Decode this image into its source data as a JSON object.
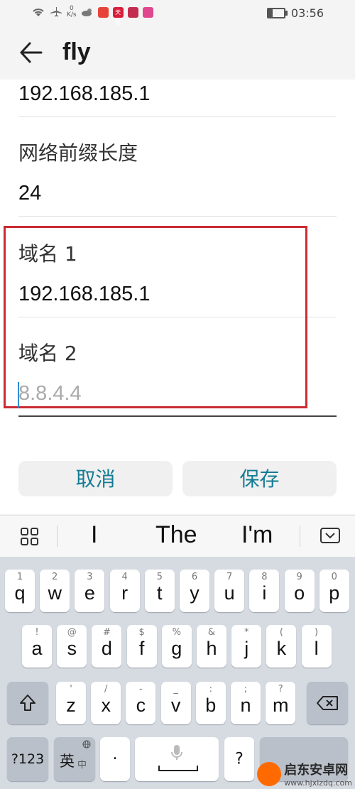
{
  "status": {
    "net_speed": "0",
    "net_unit": "K/s",
    "time": "03:56",
    "app_colors": [
      "#e8433a",
      "#d81e3c",
      "#c42c4f",
      "#e0478f"
    ],
    "app_text": "天猫"
  },
  "header": {
    "title": "fly",
    "back_icon": "arrow-left-icon"
  },
  "form": {
    "gateway_value": "192.168.185.1",
    "prefix_label": "网络前缀长度",
    "prefix_value": "24",
    "dns1_label": "域名 1",
    "dns1_value": "192.168.185.1",
    "dns2_label": "域名 2",
    "dns2_placeholder": "8.8.4.4",
    "highlight_color": "#cc2b33"
  },
  "buttons": {
    "cancel": "取消",
    "save": "保存",
    "accent": "#137b94"
  },
  "keyboard": {
    "suggestions": [
      "I",
      "The",
      "I'm"
    ],
    "row1": [
      {
        "sub": "1",
        "main": "q"
      },
      {
        "sub": "2",
        "main": "w"
      },
      {
        "sub": "3",
        "main": "e"
      },
      {
        "sub": "4",
        "main": "r"
      },
      {
        "sub": "5",
        "main": "t"
      },
      {
        "sub": "6",
        "main": "y"
      },
      {
        "sub": "7",
        "main": "u"
      },
      {
        "sub": "8",
        "main": "i"
      },
      {
        "sub": "9",
        "main": "o"
      },
      {
        "sub": "0",
        "main": "p"
      }
    ],
    "row2": [
      {
        "sub": "!",
        "main": "a"
      },
      {
        "sub": "@",
        "main": "s"
      },
      {
        "sub": "#",
        "main": "d"
      },
      {
        "sub": "$",
        "main": "f"
      },
      {
        "sub": "%",
        "main": "g"
      },
      {
        "sub": "&",
        "main": "h"
      },
      {
        "sub": "*",
        "main": "j"
      },
      {
        "sub": "(",
        "main": "k"
      },
      {
        "sub": ")",
        "main": "l"
      }
    ],
    "row3": [
      {
        "sub": "'",
        "main": "z"
      },
      {
        "sub": "/",
        "main": "x"
      },
      {
        "sub": "-",
        "main": "c"
      },
      {
        "sub": "_",
        "main": "v"
      },
      {
        "sub": ":",
        "main": "b"
      },
      {
        "sub": ";",
        "main": "n"
      },
      {
        "sub": "?",
        "main": "m"
      }
    ],
    "num_key": "?123",
    "lang_key": "英",
    "lang_sub": "中",
    "dot_key": "·",
    "question_key": "?"
  },
  "watermark": {
    "text": "启东安卓网",
    "url": "www.hjxlzdq.com"
  }
}
